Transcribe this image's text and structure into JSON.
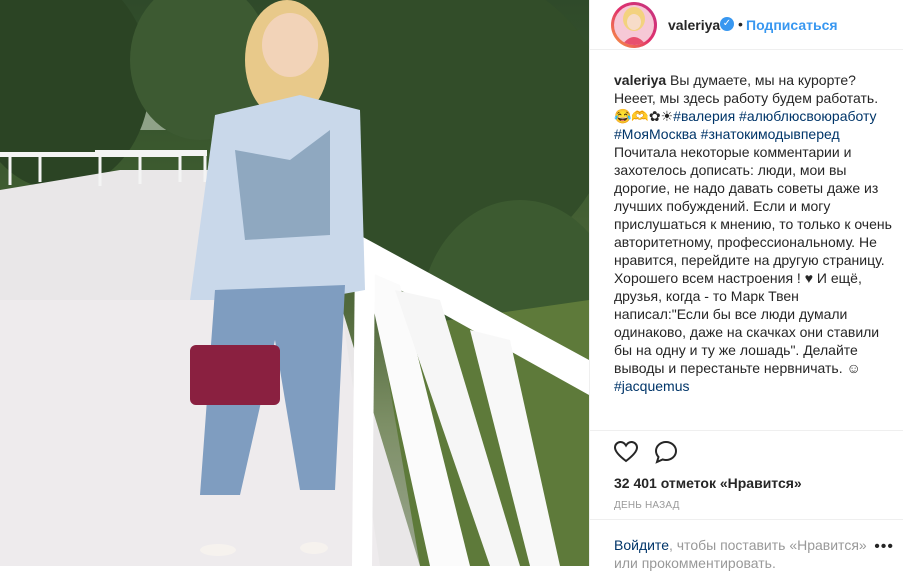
{
  "photo": {
    "alt": ""
  },
  "header": {
    "username": "valeriya",
    "separator": "•",
    "follow_label": "Подписаться"
  },
  "caption": {
    "username": "valeriya",
    "text_1": " Вы думаете, мы на курорте? Нееет, мы здесь работу будем работать. 😂🫶✿☀",
    "tags_1": "#валерия #алюблюсвоюработу #МояМосква #знатокимодывперед",
    "text_2": "Почитала некоторые комментарии и захотелось дописать: люди, мои вы дорогие, не надо давать советы даже из лучших побуждений. Если и могу прислушаться к мнению, то только к очень авторитетному, профессиональному. Не нравится, перейдите на другую страницу. Хорошего всем настроения ! ♥ И ещё, друзья, когда - то Марк Твен написал:\"Если бы все люди думали одинаково, даже на скачках они ставили бы на одну и ту же лошадь\". Делайте выводы и перестаньте нервничать. ☺",
    "tags_2": "#jacquemus"
  },
  "actions": {
    "likes": "32 401 отметок «Нравится»",
    "time": "ДЕНЬ НАЗАД"
  },
  "login": {
    "link": "Войдите",
    "text": ", чтобы поставить «Нравится» или прокомментировать.",
    "more": "•••"
  }
}
